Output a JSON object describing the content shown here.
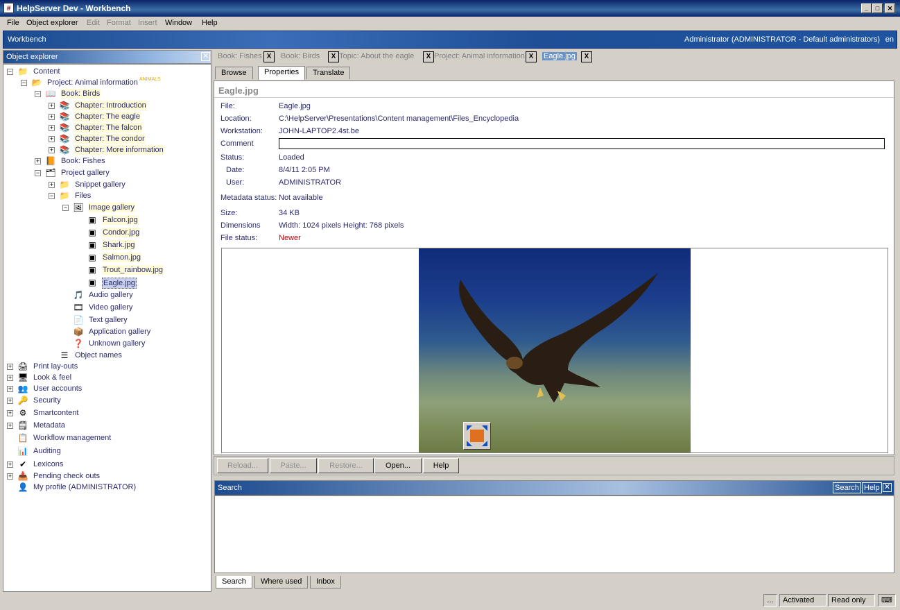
{
  "window": {
    "title": "HelpServer Dev - Workbench",
    "app_icon": "hs-icon"
  },
  "menu": [
    {
      "label": "File",
      "enabled": true
    },
    {
      "label": "Object explorer",
      "enabled": true
    },
    {
      "label": "Edit",
      "enabled": false
    },
    {
      "label": "Format",
      "enabled": false
    },
    {
      "label": "Insert",
      "enabled": false
    },
    {
      "label": "Window",
      "enabled": true
    },
    {
      "label": "Help",
      "enabled": true
    }
  ],
  "workbench": {
    "title": "Workbench",
    "user": "Administrator (ADMINISTRATOR - Default administrators)",
    "lang": "en"
  },
  "explorer": {
    "title": "Object explorer",
    "tree": [
      {
        "label": "Content",
        "icon": "folder-icon",
        "exp": "-"
      },
      {
        "label": "Project: Animal information",
        "icon": "project-folder-icon",
        "exp": "-",
        "badge": "ANIMALS"
      },
      {
        "label": "Book: Birds",
        "icon": "book-open-icon",
        "exp": "-",
        "hl": true
      },
      {
        "label": "Chapter: Introduction",
        "icon": "chapter-icon",
        "exp": "+",
        "hl": true
      },
      {
        "label": "Chapter: The eagle",
        "icon": "chapter-icon",
        "exp": "+",
        "hl": true
      },
      {
        "label": "Chapter: The falcon",
        "icon": "chapter-icon",
        "exp": "+",
        "hl": true
      },
      {
        "label": "Chapter: The condor",
        "icon": "chapter-icon",
        "exp": "+",
        "hl": true
      },
      {
        "label": "Chapter: More information",
        "icon": "chapter-icon",
        "exp": "+",
        "hl": true
      },
      {
        "label": "Book: Fishes",
        "icon": "book-icon",
        "exp": "+"
      },
      {
        "label": "Project gallery",
        "icon": "gallery-icon",
        "exp": "-"
      },
      {
        "label": "Snippet gallery",
        "icon": "folder-icon",
        "exp": "+"
      },
      {
        "label": "Files",
        "icon": "folder-icon",
        "exp": "-"
      },
      {
        "label": "Image gallery",
        "icon": "image-folder-icon",
        "exp": "-",
        "hl": true
      },
      {
        "label": "Falcon.jpg",
        "icon": "image-file-icon",
        "hl": true
      },
      {
        "label": "Condor.jpg",
        "icon": "image-file-icon",
        "hl": true
      },
      {
        "label": "Shark.jpg",
        "icon": "image-file-icon",
        "hl": true
      },
      {
        "label": "Salmon.jpg",
        "icon": "image-file-icon",
        "hl": true
      },
      {
        "label": "Trout_rainbow.jpg",
        "icon": "image-file-icon",
        "hl": true
      },
      {
        "label": "Eagle.jpg",
        "icon": "image-file-icon",
        "selected": true
      },
      {
        "label": "Audio gallery",
        "icon": "audio-folder-icon"
      },
      {
        "label": "Video gallery",
        "icon": "video-folder-icon"
      },
      {
        "label": "Text gallery",
        "icon": "text-folder-icon"
      },
      {
        "label": "Application gallery",
        "icon": "app-folder-icon"
      },
      {
        "label": "Unknown gallery",
        "icon": "unknown-folder-icon"
      },
      {
        "label": "Object names",
        "icon": "list-icon"
      },
      {
        "label": "Print lay-outs",
        "icon": "printer-icon",
        "exp": "+"
      },
      {
        "label": "Look & feel",
        "icon": "monitor-icon",
        "exp": "+"
      },
      {
        "label": "User accounts",
        "icon": "users-icon",
        "exp": "+"
      },
      {
        "label": "Security",
        "icon": "key-icon",
        "exp": "+"
      },
      {
        "label": "Smartcontent",
        "icon": "smartcontent-icon",
        "exp": "+"
      },
      {
        "label": "Metadata",
        "icon": "metadata-icon",
        "exp": "+"
      },
      {
        "label": "Workflow management",
        "icon": "workflow-icon"
      },
      {
        "label": "Auditing",
        "icon": "chart-icon"
      },
      {
        "label": "Lexicons",
        "icon": "spellcheck-icon",
        "exp": "+"
      },
      {
        "label": "Pending check outs",
        "icon": "checkout-icon",
        "exp": "+"
      },
      {
        "label": "My profile (ADMINISTRATOR)",
        "icon": "person-icon"
      }
    ]
  },
  "doc_tabs": [
    {
      "label": "Book: Fishes"
    },
    {
      "label": "Book: Birds"
    },
    {
      "label": "Topic: About the eagle"
    },
    {
      "label": "Project: Animal information"
    },
    {
      "label": "Eagle.jpg",
      "active": true
    }
  ],
  "sub_tabs": [
    {
      "label": "Browse"
    },
    {
      "label": "Properties",
      "active": true
    },
    {
      "label": "Translate"
    }
  ],
  "properties": {
    "heading": "Eagle.jpg",
    "fields": [
      {
        "key": "File:",
        "value": "Eagle.jpg"
      },
      {
        "key": "Location:",
        "value": "C:\\HelpServer\\Presentations\\Content management\\Files_Encyclopedia"
      },
      {
        "key": "Workstation:",
        "value": "JOHN-LAPTOP2.4st.be"
      },
      {
        "key": "Comment",
        "value": ""
      },
      {
        "key": "Status:",
        "value": "Loaded"
      },
      {
        "key": "Date:",
        "value": "8/4/11 2:05 PM"
      },
      {
        "key": "User:",
        "value": "ADMINISTRATOR"
      },
      {
        "key": "Metadata status:",
        "value": "Not available"
      },
      {
        "key": "Size:",
        "value": "34 KB"
      },
      {
        "key": "Dimensions",
        "value": "Width: 1024 pixels Height: 768 pixels"
      },
      {
        "key": "File status:",
        "value": "Newer",
        "color": "#c00000"
      }
    ]
  },
  "actions": [
    {
      "label": "Reload...",
      "enabled": false
    },
    {
      "label": "Paste...",
      "enabled": false
    },
    {
      "label": "Restore...",
      "enabled": false
    },
    {
      "label": "Open...",
      "enabled": true
    },
    {
      "label": "Help",
      "enabled": true
    }
  ],
  "search": {
    "title": "Search",
    "search_btn": "Search",
    "help_btn": "Help"
  },
  "bottom_tabs": [
    {
      "label": "Search",
      "active": true
    },
    {
      "label": "Where used"
    },
    {
      "label": "Inbox"
    }
  ],
  "status": {
    "more": "...",
    "state": "Activated",
    "mode": "Read only"
  }
}
